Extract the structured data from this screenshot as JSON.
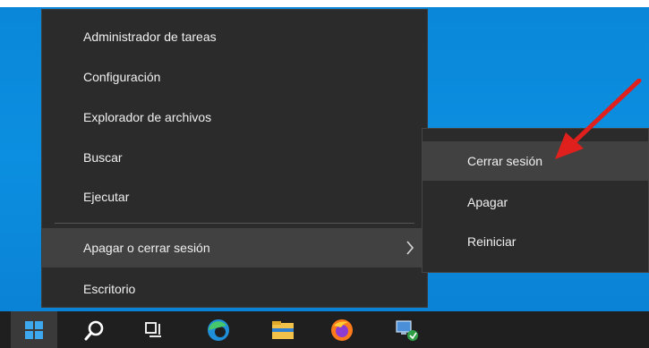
{
  "menu": {
    "items": [
      {
        "label": "Administrador de tareas"
      },
      {
        "label": "Configuración"
      },
      {
        "label": "Explorador de archivos"
      },
      {
        "label": "Buscar"
      },
      {
        "label": "Ejecutar"
      },
      {
        "label": "Apagar o cerrar sesión",
        "submenu_indicator": "chevron-right-icon"
      },
      {
        "label": "Escritorio"
      }
    ]
  },
  "submenu": {
    "items": [
      {
        "label": "Cerrar sesión"
      },
      {
        "label": "Apagar"
      },
      {
        "label": "Reiniciar"
      }
    ]
  },
  "taskbar": {
    "icons": [
      "windows-start-icon",
      "search-icon",
      "task-view-icon",
      "edge-icon",
      "file-explorer-icon",
      "firefox-icon",
      "network-app-icon"
    ]
  },
  "colors": {
    "desktop": "#0a86d8",
    "menu_bg": "#2b2b2b",
    "menu_hover": "#414141",
    "annotation_arrow": "#e0201c"
  }
}
